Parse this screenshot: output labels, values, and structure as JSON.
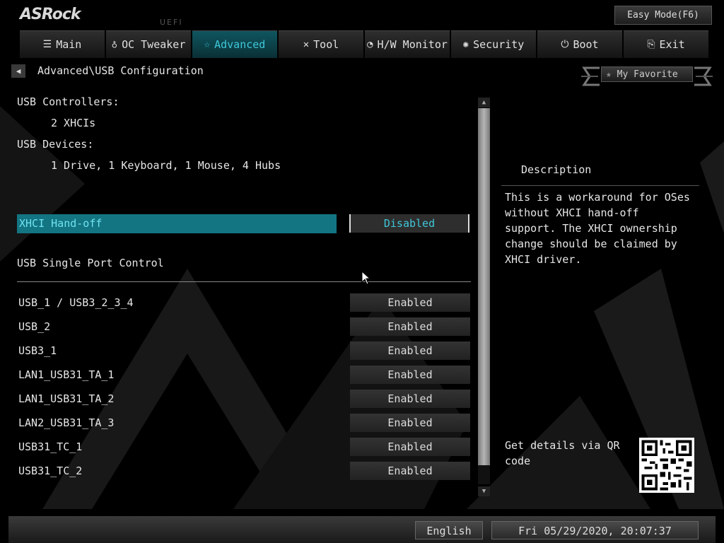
{
  "header": {
    "logo": "ASRock",
    "uefi_label": "UEFI",
    "easy_mode": "Easy Mode(F6)"
  },
  "tabs": [
    {
      "label": "Main",
      "icon": "list-icon",
      "active": false
    },
    {
      "label": "OC Tweaker",
      "icon": "rocket-icon",
      "active": false
    },
    {
      "label": "Advanced",
      "icon": "star-icon",
      "active": true
    },
    {
      "label": "Tool",
      "icon": "wrench-icon",
      "active": false
    },
    {
      "label": "H/W Monitor",
      "icon": "gauge-icon",
      "active": false
    },
    {
      "label": "Security",
      "icon": "shield-icon",
      "active": false
    },
    {
      "label": "Boot",
      "icon": "power-icon",
      "active": false
    },
    {
      "label": "Exit",
      "icon": "exit-icon",
      "active": false
    }
  ],
  "breadcrumb": "Advanced\\USB Configuration",
  "favorite": "My Favorite",
  "info": {
    "controllers_label": "USB Controllers:",
    "controllers_value": "2 XHCIs",
    "devices_label": "USB Devices:",
    "devices_value": "1 Drive, 1 Keyboard, 1 Mouse, 4 Hubs"
  },
  "selected": {
    "label": "XHCI Hand-off",
    "value": "Disabled"
  },
  "section_title": "USB Single Port Control",
  "ports": [
    {
      "label": "USB_1 / USB3_2_3_4",
      "value": "Enabled"
    },
    {
      "label": "USB_2",
      "value": "Enabled"
    },
    {
      "label": "USB3_1",
      "value": "Enabled"
    },
    {
      "label": "LAN1_USB31_TA_1",
      "value": "Enabled"
    },
    {
      "label": "LAN1_USB31_TA_2",
      "value": "Enabled"
    },
    {
      "label": "LAN2_USB31_TA_3",
      "value": "Enabled"
    },
    {
      "label": "USB31_TC_1",
      "value": "Enabled"
    },
    {
      "label": "USB31_TC_2",
      "value": "Enabled"
    }
  ],
  "description": {
    "title": "Description",
    "body": "This is a workaround for OSes without XHCI hand-off support. The XHCI ownership change should be claimed by XHCI driver.",
    "qr_text": "Get details via QR code"
  },
  "footer": {
    "language": "English",
    "datetime": "Fri 05/29/2020, 20:07:37"
  },
  "colors": {
    "accent": "#3fc7d8",
    "selection_bg": "#137482"
  }
}
